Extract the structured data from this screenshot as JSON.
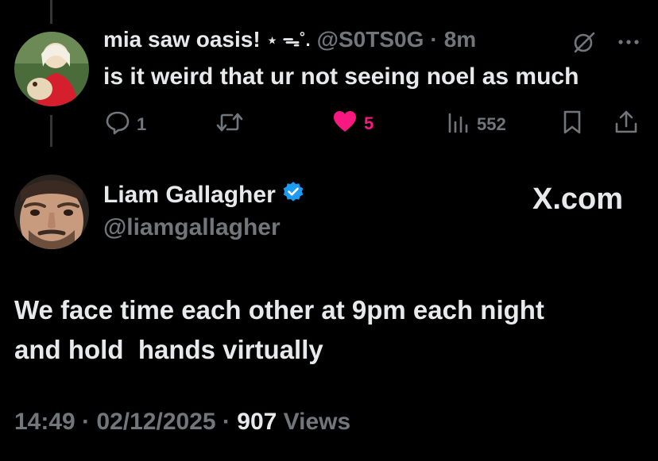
{
  "colors": {
    "background": "#000000",
    "text": "#e7e9ea",
    "muted": "#71767b",
    "like": "#f91880",
    "verified": "#1d9bf0"
  },
  "reply": {
    "display_name": "mia saw oasis!",
    "decoration": "⋆ ᯓ˚.",
    "handle": "@S0TS0G",
    "separator": "·",
    "time": "8m",
    "text": "is it weird that ur not seeing noel as much",
    "icons": [
      "grok-icon",
      "more-icon"
    ],
    "actions": {
      "replies": "1",
      "reposts": "",
      "likes": "5",
      "views": "552"
    }
  },
  "post": {
    "author_name": "Liam Gallagher",
    "verified": true,
    "author_handle": "@liamgallagher",
    "brand": "X.com",
    "body_lines": [
      "We face time each other at 9pm each night",
      "and hold  hands virtually"
    ],
    "time": "14:49",
    "separator": "·",
    "date": "02/12/2025",
    "views_count": "907",
    "views_label": "Views"
  }
}
